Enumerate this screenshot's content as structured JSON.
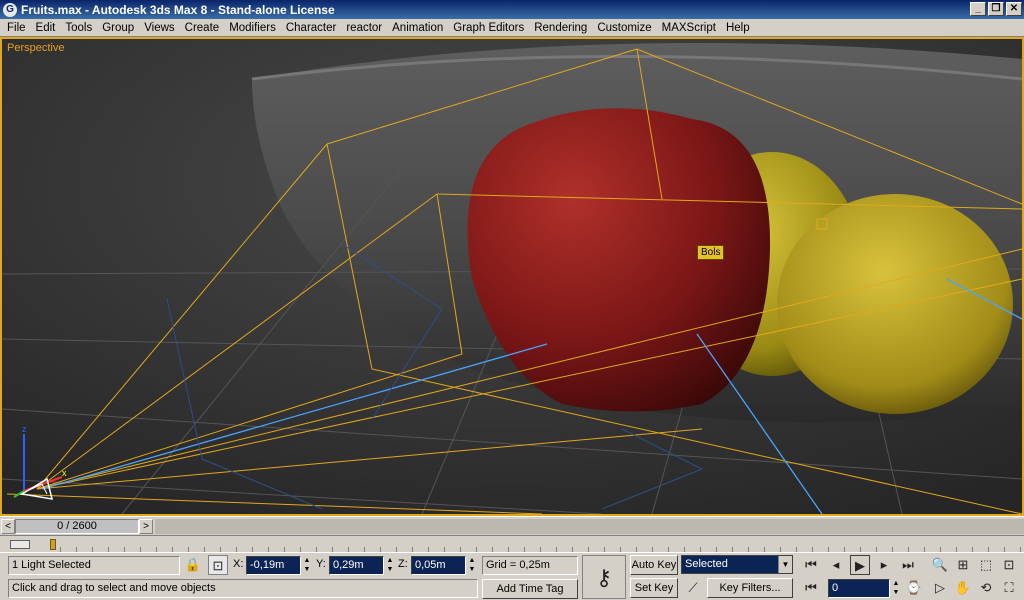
{
  "window": {
    "title": "Fruits.max - Autodesk 3ds Max 8  - Stand-alone License",
    "app_icon": "3ds-max-icon"
  },
  "menu": [
    "File",
    "Edit",
    "Tools",
    "Group",
    "Views",
    "Create",
    "Modifiers",
    "Character",
    "reactor",
    "Animation",
    "Graph Editors",
    "Rendering",
    "Customize",
    "MAXScript",
    "Help"
  ],
  "viewport": {
    "label": "Perspective",
    "tooltip": "Bols",
    "axis_labels": {
      "x": "x",
      "z": "z"
    },
    "border_color": "#e2a81b"
  },
  "timeslider": {
    "frame": "0 / 2600",
    "prev": "<",
    "next": ">"
  },
  "status": {
    "selection": "1 Light Selected",
    "prompt": "Click and drag to select and move objects",
    "x_label": "X:",
    "x_value": "-0,19m",
    "y_label": "Y:",
    "y_value": "0,29m",
    "z_label": "Z:",
    "z_value": "0,05m",
    "grid": "Grid = 0,25m",
    "add_time_tag": "Add Time Tag",
    "auto_key": "Auto Key",
    "set_key": "Set Key",
    "key_mode": "Selected",
    "key_filters": "Key Filters...",
    "current_frame": "0"
  },
  "colors": {
    "selection_yellow": "#e2a81b",
    "light_blue": "#4aa3ff",
    "viewport_bg": "#333333"
  }
}
